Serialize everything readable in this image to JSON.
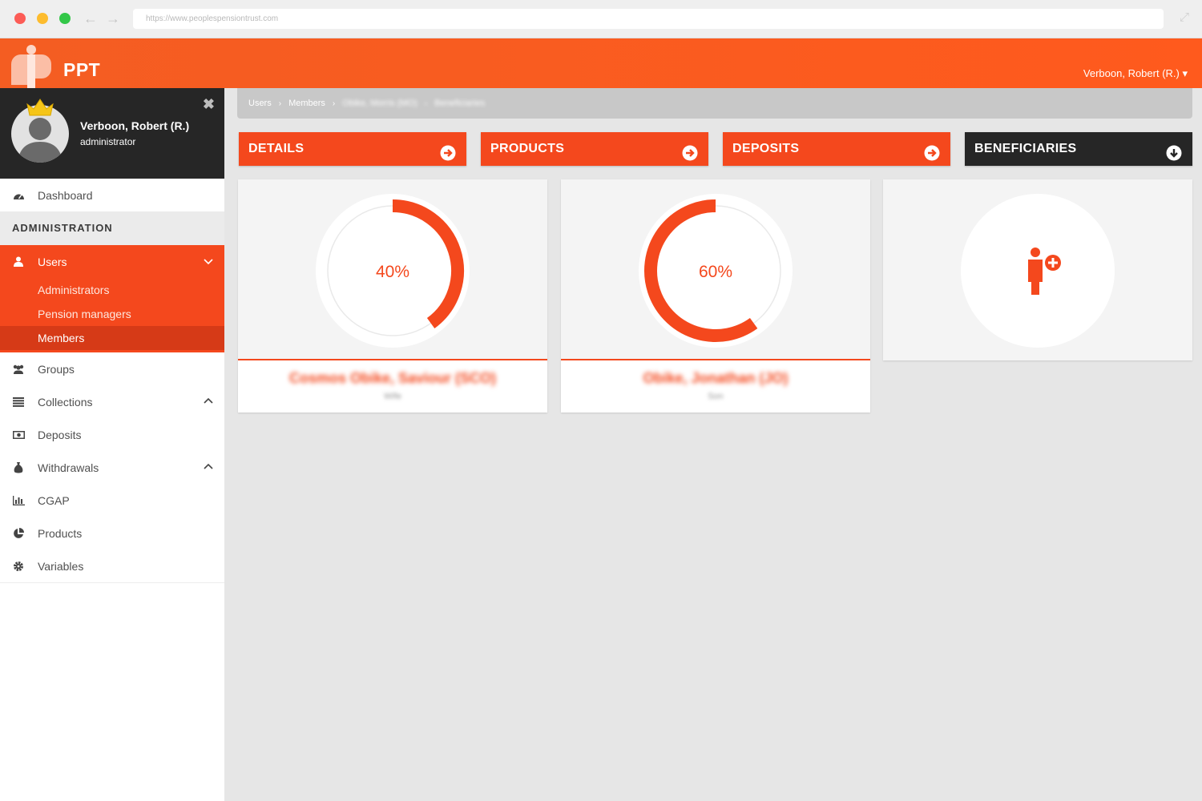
{
  "browser": {
    "url": "https://www.peoplespensiontrust.com"
  },
  "header": {
    "brand": "PPT",
    "user_menu": "Verboon, Robert (R.) ▾"
  },
  "profile": {
    "name": "Verboon, Robert (R.)",
    "role": "administrator"
  },
  "sidebar": {
    "dashboard": "Dashboard",
    "section": "ADMINISTRATION",
    "users": "Users",
    "sub_items": [
      "Administrators",
      "Pension managers",
      "Members"
    ],
    "groups": "Groups",
    "collections": "Collections",
    "deposits": "Deposits",
    "withdrawals": "Withdrawals",
    "cgap": "CGAP",
    "products": "Products",
    "variables": "Variables"
  },
  "breadcrumb": [
    "Users",
    "Members",
    "Obike, Morris (MO)",
    "Beneficiaries"
  ],
  "tabs": [
    "DETAILS",
    "PRODUCTS",
    "DEPOSITS",
    "BENEFICIARIES"
  ],
  "cards": [
    {
      "percent_label": "40%",
      "percent": 40,
      "name": "Cosmos Obike, Saviour (SCO)",
      "relation": "Wife"
    },
    {
      "percent_label": "60%",
      "percent": 60,
      "name": "Obike, Jonathan (JO)",
      "relation": "Son"
    }
  ],
  "colors": {
    "accent": "#f4481d",
    "dark": "#262626"
  }
}
